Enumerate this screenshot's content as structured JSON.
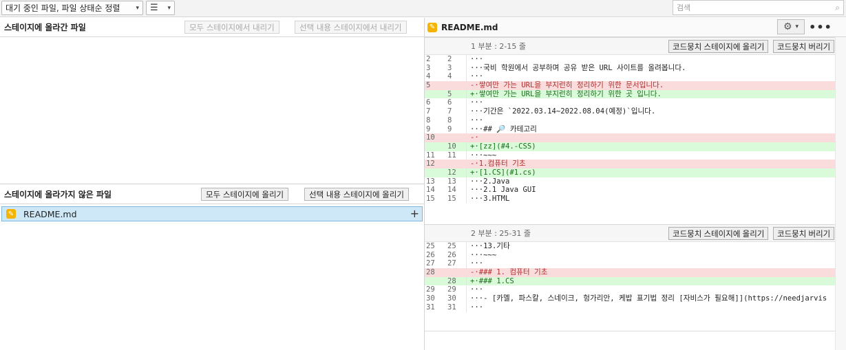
{
  "toolbar": {
    "sort_label": "대기 중인 파일, 파일 상태순 정렬",
    "view_icon": "list-icon",
    "search_placeholder": "검색"
  },
  "staged": {
    "title": "스테이지에 올라간 파일",
    "unstage_all": "모두 스테이지에서 내리기",
    "unstage_selected": "선택 내용 스테이지에서 내리기"
  },
  "unstaged": {
    "title": "스테이지에 올라가지 않은 파일",
    "stage_all": "모두 스테이지에 올리기",
    "stage_selected": "선택 내용 스테이지에 올리기",
    "files": [
      {
        "name": "README.md",
        "icon": "pencil-icon",
        "status_color": "#f4b400"
      }
    ]
  },
  "diff": {
    "file_name": "README.md",
    "stage_hunk": "코드뭉치 스테이지에 올리기",
    "discard_hunk": "코드뭉치 버리기",
    "hunks": [
      {
        "label": "1 부분 : 2-15 줄",
        "lines": [
          {
            "o": "2",
            "n": "2",
            "t": "",
            "c": "···"
          },
          {
            "o": "3",
            "n": "3",
            "t": "",
            "c": "···국비 학원에서 공부하며 공유 받은 URL 사이트를 올려봅니다."
          },
          {
            "o": "4",
            "n": "4",
            "t": "",
            "c": "···"
          },
          {
            "o": "5",
            "n": "",
            "t": "del",
            "c": "-·쌓여만 가는 URL을 부지런히 정리하기 위한 문서입니다."
          },
          {
            "o": "",
            "n": "5",
            "t": "add",
            "c": "+·쌓여만 가는 URL을 부지런히 정리하기 위한 곳 입니다."
          },
          {
            "o": "6",
            "n": "6",
            "t": "",
            "c": "···"
          },
          {
            "o": "7",
            "n": "7",
            "t": "",
            "c": "···기간은 `2022.03.14~2022.08.04(예정)`입니다."
          },
          {
            "o": "8",
            "n": "8",
            "t": "",
            "c": "···"
          },
          {
            "o": "9",
            "n": "9",
            "t": "",
            "c": "···## 🔎 카테고리"
          },
          {
            "o": "10",
            "n": "",
            "t": "del",
            "c": "-·"
          },
          {
            "o": "",
            "n": "10",
            "t": "add",
            "c": "+·[zz](#4.-CSS)"
          },
          {
            "o": "11",
            "n": "11",
            "t": "",
            "c": "···~~~"
          },
          {
            "o": "12",
            "n": "",
            "t": "del",
            "c": "-·1.컴퓨터 기초"
          },
          {
            "o": "",
            "n": "12",
            "t": "add",
            "c": "+·[1.CS](#1.cs)"
          },
          {
            "o": "13",
            "n": "13",
            "t": "",
            "c": "···2.Java"
          },
          {
            "o": "14",
            "n": "14",
            "t": "",
            "c": "···2.1 Java GUI"
          },
          {
            "o": "15",
            "n": "15",
            "t": "",
            "c": "···3.HTML"
          }
        ]
      },
      {
        "label": "2 부분 : 25-31 줄",
        "lines": [
          {
            "o": "25",
            "n": "25",
            "t": "",
            "c": "···13.기타"
          },
          {
            "o": "26",
            "n": "26",
            "t": "",
            "c": "···~~~"
          },
          {
            "o": "27",
            "n": "27",
            "t": "",
            "c": "···"
          },
          {
            "o": "28",
            "n": "",
            "t": "del",
            "c": "-·### 1. 컴퓨터 기초"
          },
          {
            "o": "",
            "n": "28",
            "t": "add",
            "c": "+·### 1.CS"
          },
          {
            "o": "29",
            "n": "29",
            "t": "",
            "c": "···"
          },
          {
            "o": "30",
            "n": "30",
            "t": "",
            "c": "···- [카멜, 파스칼, 스네이크, 헝가리안, 케밥 표기법 정리 [자비스가 필요해]](https://needjarvis"
          },
          {
            "o": "31",
            "n": "31",
            "t": "",
            "c": "···"
          }
        ]
      }
    ]
  }
}
